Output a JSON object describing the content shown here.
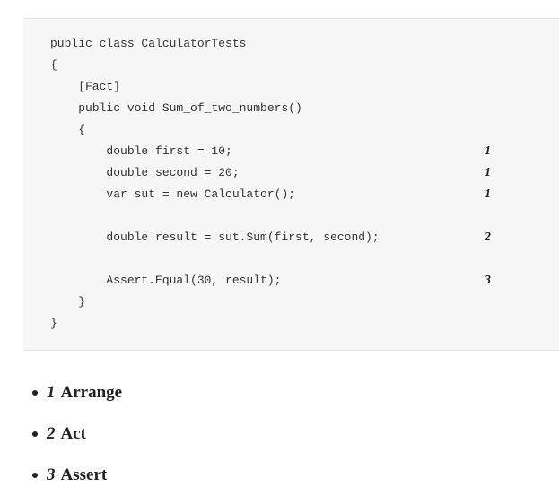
{
  "code": {
    "lines": [
      "public class CalculatorTests",
      "{",
      "    [Fact]",
      "    public void Sum_of_two_numbers()",
      "    {",
      "        double first = 10;",
      "        double second = 20;",
      "        var sut = new Calculator();",
      "",
      "        double result = sut.Sum(first, second);",
      "",
      "        Assert.Equal(30, result);",
      "    }",
      "}"
    ],
    "markers": [
      "1",
      "1",
      "1",
      "2",
      "3"
    ]
  },
  "legend": [
    {
      "number": "1",
      "label": "Arrange"
    },
    {
      "number": "2",
      "label": "Act"
    },
    {
      "number": "3",
      "label": "Assert"
    }
  ]
}
